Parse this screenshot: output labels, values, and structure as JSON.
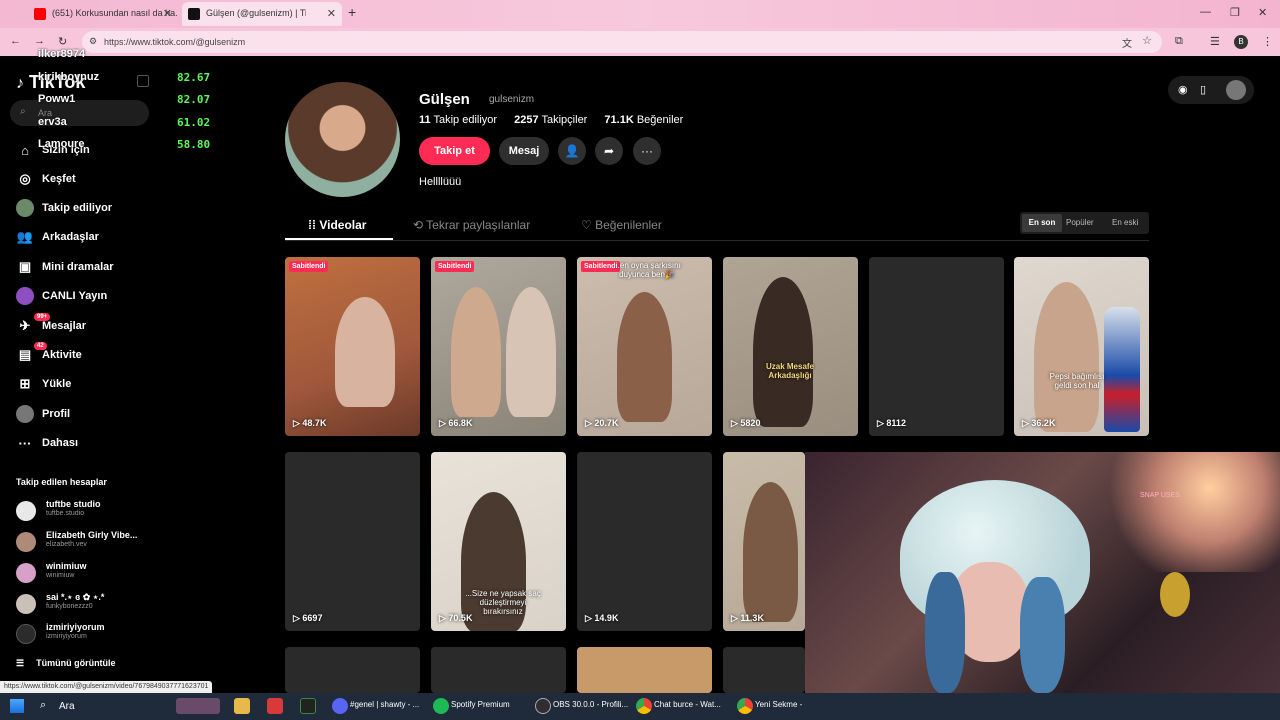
{
  "browser": {
    "tabs": [
      {
        "title": "(651) Korkusundan nasıl da ha...",
        "active": false
      },
      {
        "title": "Gülşen (@gulsenizm) | TikT...",
        "active": true
      }
    ],
    "url": "https://www.tiktok.com/@gulsenizm",
    "new_tab": "+",
    "profile_initial": "B",
    "status_url": "https://www.tiktok.com/@gulsenizm/video/7679849037771623701"
  },
  "overlay_leaderboard": [
    {
      "name": "ilker8974",
      "score": ""
    },
    {
      "name": "kirikboynuz",
      "score": "82.67"
    },
    {
      "name": "Poww1",
      "score": "82.07"
    },
    {
      "name": "erv3a",
      "score": "61.02"
    },
    {
      "name": "Lamoure",
      "score": "58.80"
    }
  ],
  "sidebar": {
    "logo": "TikTok",
    "search_placeholder": "Ara",
    "nav": [
      {
        "label": "Sizin için",
        "icon": "home-icon"
      },
      {
        "label": "Keşfet",
        "icon": "compass-icon"
      },
      {
        "label": "Takip ediliyor",
        "icon": "following-avatar-icon"
      },
      {
        "label": "Arkadaşlar",
        "icon": "friends-icon"
      },
      {
        "label": "Mini dramalar",
        "icon": "mini-drama-icon"
      },
      {
        "label": "CANLI Yayın",
        "icon": "live-icon"
      },
      {
        "label": "Mesajlar",
        "icon": "messages-icon",
        "badge": "99+"
      },
      {
        "label": "Aktivite",
        "icon": "activity-icon",
        "badge": "42"
      },
      {
        "label": "Yükle",
        "icon": "upload-icon"
      },
      {
        "label": "Profil",
        "icon": "profile-icon"
      },
      {
        "label": "Dahası",
        "icon": "more-dots-icon"
      }
    ],
    "following_title": "Takip edilen hesaplar",
    "following": [
      {
        "name": "tuftbe studio",
        "user": "tuftbe.studio",
        "color": "#e8e8e8"
      },
      {
        "name": "Elizabeth Girly Vibe...",
        "user": "elizabeth.vev",
        "color": "#b08a78"
      },
      {
        "name": "winimiuw",
        "user": "winimiuw",
        "color": "#d7a0c8"
      },
      {
        "name": "sai *.⋆ ɞ ✿ ⋆.*",
        "user": "funkybonezzz0",
        "color": "#c9c0b8"
      },
      {
        "name": "izmiriyiyorum",
        "user": "izmiriyiyorum",
        "color": "#2b2b2b"
      }
    ],
    "see_all": "Tümünü görüntüle"
  },
  "profile": {
    "display_name": "Gülşen",
    "username": "gulsenizm",
    "following_count": "11",
    "following_label": "Takip ediliyor",
    "followers_count": "2257",
    "followers_label": "Takipçiler",
    "likes_count": "71.1K",
    "likes_label": "Beğeniler",
    "follow_btn": "Takip et",
    "message_btn": "Mesaj",
    "bio": "Hellllüüü"
  },
  "content_tabs": [
    {
      "label": "Videolar",
      "active": true
    },
    {
      "label": "Tekrar paylaşılanlar",
      "active": false
    },
    {
      "label": "Beğenilenler",
      "active": false
    }
  ],
  "sort": {
    "options": [
      "En son",
      "Popüler",
      "En eski"
    ],
    "selected": "En son"
  },
  "videos": [
    {
      "views": "48.7K",
      "pinned": "Sabitlendi",
      "caption": "",
      "bg": "#a0583c"
    },
    {
      "views": "66.8K",
      "pinned": "Sabitlendi",
      "caption": "",
      "bg": "#8a8478"
    },
    {
      "views": "20.7K",
      "pinned": "Sabitlendi",
      "caption": "...en oyna şarkısını duyunca ben🎉",
      "bg": "#b8a89a"
    },
    {
      "views": "5820",
      "pinned": "",
      "caption": "Uzak Mesafe Arkadaşlığı",
      "bg": "#9a8e80"
    },
    {
      "views": "8112",
      "pinned": "",
      "caption": "",
      "bg": "#2a2a2a"
    },
    {
      "views": "36.2K",
      "pinned": "",
      "caption": "Pepsi bağımlısı geldi son hal",
      "bg": "#c8c0b6"
    },
    {
      "views": "6697",
      "pinned": "",
      "caption": "",
      "bg": "#2a2a2a"
    },
    {
      "views": "70.5K",
      "pinned": "",
      "caption": "...Size ne yapsak saç düzleştirmeyi bırakırsınız",
      "bg": "#d8d2c8"
    },
    {
      "views": "14.9K",
      "pinned": "",
      "caption": "",
      "bg": "#2a2a2a"
    },
    {
      "views": "11.3K",
      "pinned": "",
      "caption": "",
      "bg": "#b8aa98"
    }
  ],
  "webcam_sign": "SNAP USES",
  "taskbar": {
    "search": "Ara",
    "apps": [
      {
        "label": "#genel | shawty - ...",
        "color": "#5865f2"
      },
      {
        "label": "Spotify Premium",
        "color": "#1db954"
      },
      {
        "label": "OBS 30.0.0 - Profili...",
        "color": "#302e31"
      },
      {
        "label": "Chat burce - Wat...",
        "color": "#ea4335"
      },
      {
        "label": "Yeni Sekme - C...",
        "color": "#ea4335"
      }
    ]
  },
  "colors": {
    "accent": "#fe2c55",
    "chrome_pink": "#f7c6da"
  }
}
